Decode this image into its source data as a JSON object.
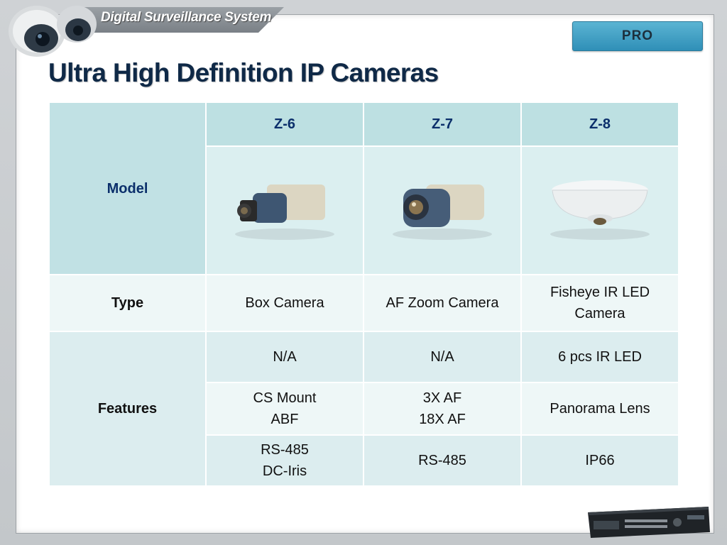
{
  "header": {
    "banner_text": "Digital Surveillance System",
    "pro_label": "PRO"
  },
  "slide": {
    "title": "Ultra High Definition IP Cameras"
  },
  "table": {
    "model_label": "Model",
    "models": [
      "Z-6",
      "Z-7",
      "Z-8"
    ],
    "type_label": "Type",
    "types": [
      {
        "l1": "Box Camera",
        "l2": ""
      },
      {
        "l1": "AF Zoom Camera",
        "l2": ""
      },
      {
        "l1": "Fisheye IR LED",
        "l2": "Camera"
      }
    ],
    "features_label": "Features",
    "features": [
      [
        {
          "l1": "N/A",
          "l2": ""
        },
        {
          "l1": "N/A",
          "l2": ""
        },
        {
          "l1": "6 pcs IR LED",
          "l2": ""
        }
      ],
      [
        {
          "l1": "CS Mount",
          "l2": "ABF"
        },
        {
          "l1": "3X AF",
          "l2": "18X AF"
        },
        {
          "l1": "Panorama Lens",
          "l2": ""
        }
      ],
      [
        {
          "l1": "RS-485",
          "l2": "DC-Iris"
        },
        {
          "l1": "RS-485",
          "l2": ""
        },
        {
          "l1": "IP66",
          "l2": ""
        }
      ]
    ]
  },
  "colors": {
    "title": "#0f2947",
    "header_cell": "#bde0e2",
    "pro_button": "#3fa1c6"
  },
  "icons": [
    "ptz-dome-camera-icon",
    "box-camera-icon",
    "zoom-camera-icon",
    "fisheye-camera-icon",
    "dvr-recorder-icon"
  ]
}
